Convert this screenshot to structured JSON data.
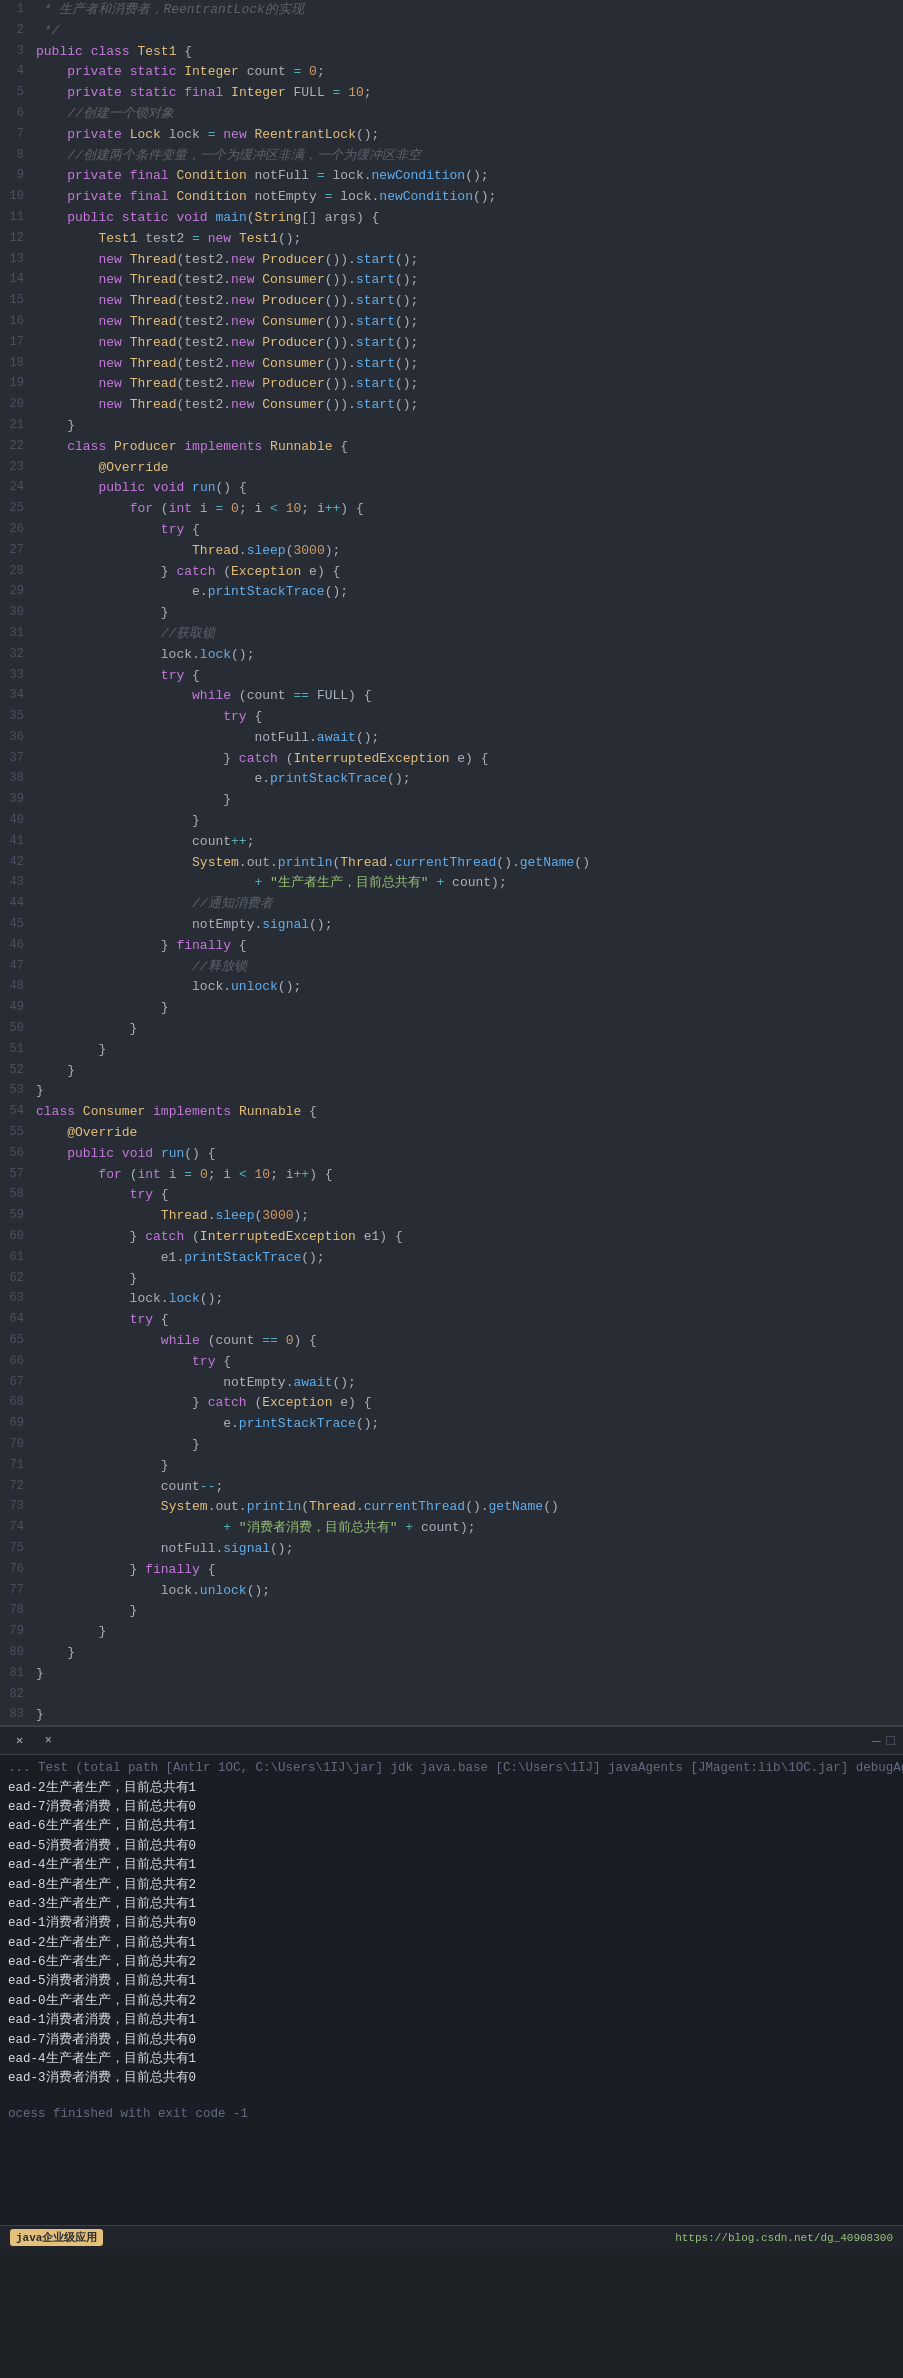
{
  "editor": {
    "lines": [
      {
        "num": 1,
        "text": " * 生产者和消费者，ReentrantLock的实现",
        "class": "comment"
      },
      {
        "num": 2,
        "text": " */",
        "class": "comment"
      },
      {
        "num": 3,
        "text": "public class Test1 {",
        "class": "code"
      },
      {
        "num": 4,
        "text": "    private static Integer count = 0;",
        "class": "code"
      },
      {
        "num": 5,
        "text": "    private static final Integer FULL = 10;",
        "class": "code"
      },
      {
        "num": 6,
        "text": "    //创建一个锁对象",
        "class": "comment-inline"
      },
      {
        "num": 7,
        "text": "    private Lock lock = new ReentrantLock();",
        "class": "code"
      },
      {
        "num": 8,
        "text": "    //创建两个条件变量，一个为缓冲区非满，一个为缓冲区非空",
        "class": "comment-inline"
      },
      {
        "num": 9,
        "text": "    private final Condition notFull = lock.newCondition();",
        "class": "code"
      },
      {
        "num": 10,
        "text": "    private final Condition notEmpty = lock.newCondition();",
        "class": "code"
      },
      {
        "num": 11,
        "text": "    public static void main(String[] args) {",
        "class": "code"
      },
      {
        "num": 12,
        "text": "        Test1 test2 = new Test1();",
        "class": "code"
      },
      {
        "num": 13,
        "text": "        new Thread(test2.new Producer()).start();",
        "class": "code"
      },
      {
        "num": 14,
        "text": "        new Thread(test2.new Consumer()).start();",
        "class": "code"
      },
      {
        "num": 15,
        "text": "        new Thread(test2.new Producer()).start();",
        "class": "code"
      },
      {
        "num": 16,
        "text": "        new Thread(test2.new Consumer()).start();",
        "class": "code"
      },
      {
        "num": 17,
        "text": "        new Thread(test2.new Producer()).start();",
        "class": "code"
      },
      {
        "num": 18,
        "text": "        new Thread(test2.new Consumer()).start();",
        "class": "code"
      },
      {
        "num": 19,
        "text": "        new Thread(test2.new Producer()).start();",
        "class": "code"
      },
      {
        "num": 20,
        "text": "        new Thread(test2.new Consumer()).start();",
        "class": "code"
      },
      {
        "num": 21,
        "text": "    }",
        "class": "code"
      },
      {
        "num": 22,
        "text": "    class Producer implements Runnable {",
        "class": "code"
      },
      {
        "num": 23,
        "text": "        @Override",
        "class": "annotation"
      },
      {
        "num": 24,
        "text": "        public void run() {",
        "class": "code"
      },
      {
        "num": 25,
        "text": "            for (int i = 0; i < 10; i++) {",
        "class": "code"
      },
      {
        "num": 26,
        "text": "                try {",
        "class": "code"
      },
      {
        "num": 27,
        "text": "                    Thread.sleep(3000);",
        "class": "code"
      },
      {
        "num": 28,
        "text": "                } catch (Exception e) {",
        "class": "code"
      },
      {
        "num": 29,
        "text": "                    e.printStackTrace();",
        "class": "code"
      },
      {
        "num": 30,
        "text": "                }",
        "class": "code"
      },
      {
        "num": 31,
        "text": "                //获取锁",
        "class": "comment-inline"
      },
      {
        "num": 32,
        "text": "                lock.lock();",
        "class": "code"
      },
      {
        "num": 33,
        "text": "                try {",
        "class": "code"
      },
      {
        "num": 34,
        "text": "                    while (count == FULL) {",
        "class": "code"
      },
      {
        "num": 35,
        "text": "                        try {",
        "class": "code"
      },
      {
        "num": 36,
        "text": "                            notFull.await();",
        "class": "code"
      },
      {
        "num": 37,
        "text": "                        } catch (InterruptedException e) {",
        "class": "code"
      },
      {
        "num": 38,
        "text": "                            e.printStackTrace();",
        "class": "code"
      },
      {
        "num": 39,
        "text": "                        }",
        "class": "code"
      },
      {
        "num": 40,
        "text": "                    }",
        "class": "code"
      },
      {
        "num": 41,
        "text": "                    count++;",
        "class": "code"
      },
      {
        "num": 42,
        "text": "                    System.out.println(Thread.currentThread().getName()",
        "class": "code"
      },
      {
        "num": 43,
        "text": "                            + \"生产者生产，目前总共有\" + count);",
        "class": "code-string"
      },
      {
        "num": 44,
        "text": "                    //通知消费者",
        "class": "comment-inline"
      },
      {
        "num": 45,
        "text": "                    notEmpty.signal();",
        "class": "code"
      },
      {
        "num": 46,
        "text": "                } finally {",
        "class": "code-finally"
      },
      {
        "num": 47,
        "text": "                    //释放锁",
        "class": "comment-inline"
      },
      {
        "num": 48,
        "text": "                    lock.unlock();",
        "class": "code"
      },
      {
        "num": 49,
        "text": "                }",
        "class": "code"
      },
      {
        "num": 50,
        "text": "            }",
        "class": "code"
      },
      {
        "num": 51,
        "text": "        }",
        "class": "code"
      },
      {
        "num": 52,
        "text": "    }",
        "class": "code"
      },
      {
        "num": 53,
        "text": "}",
        "class": "code"
      },
      {
        "num": 54,
        "text": "class Consumer implements Runnable {",
        "class": "code"
      },
      {
        "num": 55,
        "text": "    @Override",
        "class": "annotation"
      },
      {
        "num": 56,
        "text": "    public void run() {",
        "class": "code"
      },
      {
        "num": 57,
        "text": "        for (int i = 0; i < 10; i++) {",
        "class": "code"
      },
      {
        "num": 58,
        "text": "            try {",
        "class": "code"
      },
      {
        "num": 59,
        "text": "                Thread.sleep(3000);",
        "class": "code"
      },
      {
        "num": 60,
        "text": "            } catch (InterruptedException e1) {",
        "class": "code"
      },
      {
        "num": 61,
        "text": "                e1.printStackTrace();",
        "class": "code"
      },
      {
        "num": 62,
        "text": "            }",
        "class": "code"
      },
      {
        "num": 63,
        "text": "            lock.lock();",
        "class": "code"
      },
      {
        "num": 64,
        "text": "            try {",
        "class": "code"
      },
      {
        "num": 65,
        "text": "                while (count == 0) {",
        "class": "code"
      },
      {
        "num": 66,
        "text": "                    try {",
        "class": "code"
      },
      {
        "num": 67,
        "text": "                        notEmpty.await();",
        "class": "code"
      },
      {
        "num": 68,
        "text": "                    } catch (Exception e) {",
        "class": "code"
      },
      {
        "num": 69,
        "text": "                        e.printStackTrace();",
        "class": "code"
      },
      {
        "num": 70,
        "text": "                    }",
        "class": "code"
      },
      {
        "num": 71,
        "text": "                }",
        "class": "code"
      },
      {
        "num": 72,
        "text": "                count--;",
        "class": "code"
      },
      {
        "num": 73,
        "text": "                System.out.println(Thread.currentThread().getName()",
        "class": "code"
      },
      {
        "num": 74,
        "text": "                        + \"消费者消费，目前总共有\" + count);",
        "class": "code-string"
      },
      {
        "num": 75,
        "text": "                notFull.signal();",
        "class": "code"
      },
      {
        "num": 76,
        "text": "            } finally {",
        "class": "code-finally"
      },
      {
        "num": 77,
        "text": "                lock.unlock();",
        "class": "code"
      },
      {
        "num": 78,
        "text": "            }",
        "class": "code"
      },
      {
        "num": 79,
        "text": "        }",
        "class": "code"
      },
      {
        "num": 80,
        "text": "    }",
        "class": "code"
      },
      {
        "num": 81,
        "text": "}",
        "class": "code"
      },
      {
        "num": 82,
        "text": "",
        "class": "code"
      },
      {
        "num": 83,
        "text": "}",
        "class": "code"
      }
    ]
  },
  "terminal": {
    "tab_label": "✕  ×",
    "header_info": "...",
    "output_lines": [
      "ead-2生产者生产，目前总共有1",
      "ead-7消费者消费，目前总共有0",
      "ead-6生产者生产，目前总共有1",
      "ead-5消费者消费，目前总共有0",
      "ead-4生产者生产，目前总共有1",
      "ead-8生产者生产，目前总共有2",
      "ead-3生产者生产，目前总共有1",
      "ead-1消费者消费，目前总共有0",
      "ead-2生产者生产，目前总共有1",
      "ead-6生产者生产，目前总共有2",
      "ead-5消费者消费，目前总共有1",
      "ead-0生产者生产，目前总共有2",
      "ead-1消费者消费，目前总共有1",
      "ead-7消费者消费，目前总共有0",
      "ead-4生产者生产，目前总共有1",
      "ead-3消费者消费，目前总共有0"
    ],
    "exit_line": "ocess finished with exit code -1"
  },
  "status_bar": {
    "badge": "java企业级应用",
    "url": "https://blog.csdn.net/dg_40908300"
  }
}
